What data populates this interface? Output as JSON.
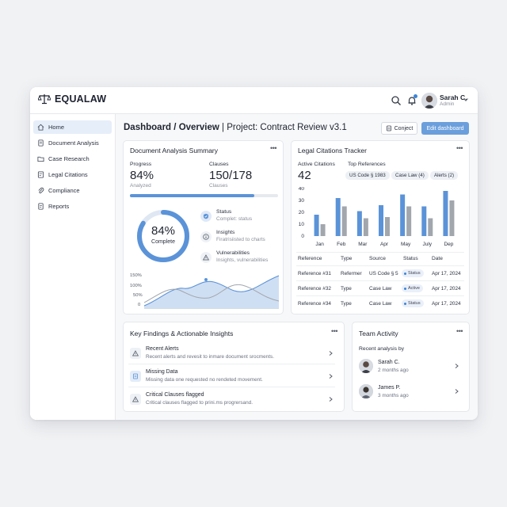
{
  "app": {
    "name": "EQUALAW"
  },
  "user": {
    "name": "Sarah C.",
    "role": "Admin"
  },
  "sidebar": {
    "items": [
      {
        "label": "Home",
        "icon": "home-icon",
        "active": true
      },
      {
        "label": "Document Analysis",
        "icon": "document-icon"
      },
      {
        "label": "Case Research",
        "icon": "folder-icon"
      },
      {
        "label": "Legal Citations",
        "icon": "citation-icon"
      },
      {
        "label": "Compliance",
        "icon": "paperclip-icon"
      },
      {
        "label": "Reports",
        "icon": "report-icon"
      }
    ]
  },
  "header": {
    "crumb_root": "Dashboard",
    "crumb_sep": "/",
    "crumb_page": "Overview",
    "crumb_divider": "|",
    "project": "Project: Contract Review v3.1",
    "conject_label": "Conject",
    "edit_label": "Edit dashboard"
  },
  "doc_analysis": {
    "title": "Document Analysis Summary",
    "progress_label": "Progress",
    "progress_value": "84%",
    "progress_sub": "Analyzed",
    "progress_fraction": 0.84,
    "clauses_label": "Clauses",
    "clauses_value": "150/178",
    "clauses_sub": "Clauses",
    "ring_value": "84%",
    "ring_label": "Complete",
    "ring_fraction": 0.84,
    "status_items": [
      {
        "title": "Status",
        "desc": "Complet: status",
        "icon": "check-shield-icon"
      },
      {
        "title": "Insights",
        "desc": "Firatrisiisted to charts",
        "icon": "info-icon"
      },
      {
        "title": "Vulnerabilities",
        "desc": "Insights, vulnerabilities",
        "icon": "warning-icon"
      }
    ],
    "mini_chart_ticks": [
      "150%",
      "100%",
      "50%",
      "0"
    ]
  },
  "citations": {
    "title": "Legal Citations Tracker",
    "active_label": "Active Citations",
    "active_value": "42",
    "top_label": "Top References",
    "tags": [
      "US Code § 1983",
      "Case Law (4)",
      "Alerts (2)"
    ],
    "table_headers": [
      "Reference",
      "Type",
      "Source",
      "Status",
      "Date"
    ],
    "rows": [
      {
        "ref": "Reference #31",
        "type": "Refermer",
        "source": "US Code § 5",
        "status": "Status",
        "date": "Apr 17, 2024"
      },
      {
        "ref": "Reference #32",
        "type": "Type",
        "source": "Case Law",
        "status": "Active",
        "date": "Apr 17, 2024"
      },
      {
        "ref": "Reference #34",
        "type": "Type",
        "source": "Case Law",
        "status": "Status",
        "date": "Apr 17, 2024"
      }
    ]
  },
  "chart_data": {
    "type": "bar",
    "categories": [
      "Jan",
      "Feb",
      "Mar",
      "Apr",
      "May",
      "July",
      "Dep"
    ],
    "series": [
      {
        "values": [
          18,
          32,
          21,
          26,
          35,
          25,
          38
        ],
        "color": "#5b93d8"
      },
      {
        "values": [
          10,
          25,
          15,
          16,
          25,
          15,
          30
        ],
        "color": "#a2a6ad"
      }
    ],
    "ylim": [
      0,
      40
    ],
    "yticks": [
      "0",
      "10",
      "20",
      "30",
      "40"
    ],
    "grid": false
  },
  "findings": {
    "title": "Key Findings & Actionable Insights",
    "items": [
      {
        "title": "Recent Alerts",
        "desc": "Recent alerts and revesit to inmare document srocments.",
        "icon": "warning-icon"
      },
      {
        "title": "Missing Data",
        "desc": "Missing data one requested no rendeted movement.",
        "icon": "document-icon"
      },
      {
        "title": "Critical Clauses flagged",
        "desc": "Critical clauses flagged to prini.ms progrersand.",
        "icon": "warning-icon"
      }
    ]
  },
  "team": {
    "title": "Team Activity",
    "subtitle": "Recent analysis by",
    "members": [
      {
        "name": "Sarah C.",
        "time": "2 months ago"
      },
      {
        "name": "James P.",
        "time": "3 months ago"
      }
    ]
  }
}
